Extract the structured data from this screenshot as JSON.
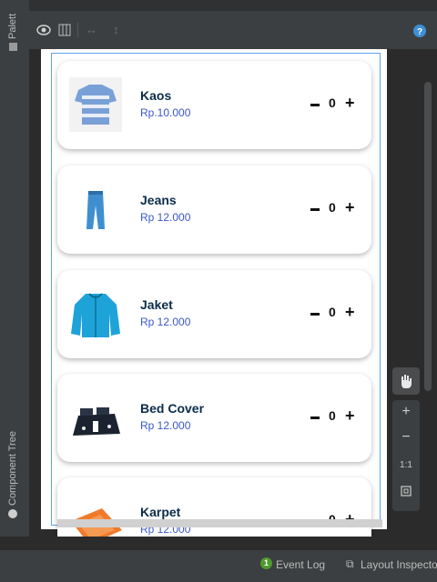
{
  "left_panel": {
    "palette_label": "Palett",
    "component_tree_label": "Component Tree"
  },
  "toolbar": {
    "icons": [
      "eye-icon",
      "columns-icon",
      "resize-horizontal-icon",
      "resize-vertical-icon",
      "help-icon"
    ]
  },
  "products": [
    {
      "name": "Kaos",
      "price": "Rp.10.000",
      "qty": "0",
      "minus": "−",
      "plus": "+"
    },
    {
      "name": "Jeans",
      "price": "Rp 12.000",
      "qty": "0",
      "minus": "−",
      "plus": "+"
    },
    {
      "name": "Jaket",
      "price": "Rp 12.000",
      "qty": "0",
      "minus": "−",
      "plus": "+"
    },
    {
      "name": "Bed Cover",
      "price": "Rp 12.000",
      "qty": "0",
      "minus": "−",
      "plus": "+"
    },
    {
      "name": "Karpet",
      "price": "Rp 12.000",
      "qty": "0",
      "minus": "−",
      "plus": "+"
    }
  ],
  "zoom": {
    "plus": "+",
    "minus": "−",
    "ratio": "1:1"
  },
  "status_bar": {
    "event_log_badge": "1",
    "event_log": "Event Log",
    "layout_inspector": "Layout Inspecto"
  },
  "colors": {
    "accent": "#3a57c8",
    "title": "#0b2c4a",
    "ide_bg": "#3c3f41",
    "outline": "#5ba4f0"
  }
}
